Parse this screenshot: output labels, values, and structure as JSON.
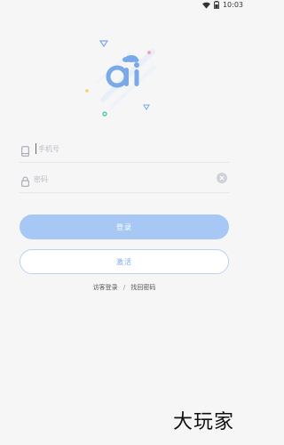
{
  "status_bar": {
    "time": "10:03"
  },
  "login": {
    "phone_placeholder": "手机号",
    "password_placeholder": "密码",
    "login_button": "登录",
    "activate_button": "激活",
    "visitor_login_link": "访客登录",
    "separator": "/",
    "find_password_link": "找回密码"
  },
  "logo": {
    "text": "ai",
    "primary_color": "#7aa9ea"
  },
  "watermark": {
    "text": "大玩家"
  },
  "colors": {
    "background": "#f6f6f7",
    "login_button": "#a7c8f4",
    "accent": "#7aa9ea"
  },
  "icons": [
    "wifi-icon",
    "battery-icon",
    "phone-icon",
    "lock-icon",
    "clear-icon"
  ]
}
